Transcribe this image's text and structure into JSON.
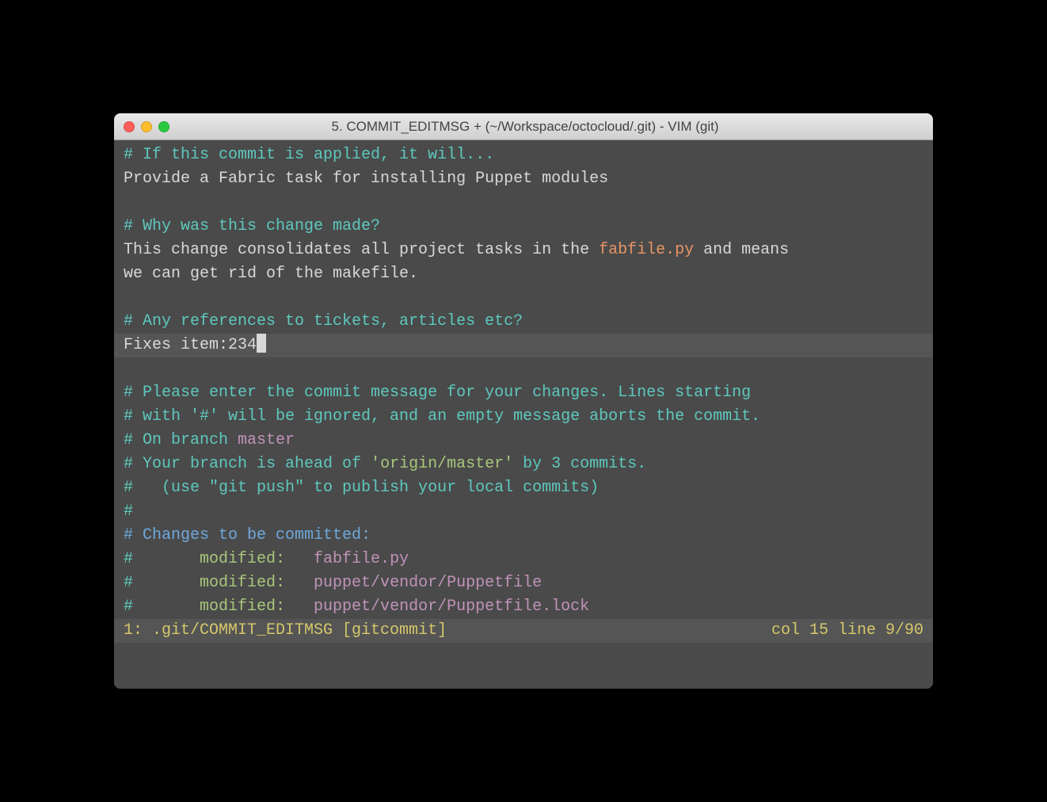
{
  "titlebar": {
    "title": "5. COMMIT_EDITMSG + (~/Workspace/octocloud/.git) - VIM (git)"
  },
  "lines": {
    "l1": "# If this commit is applied, it will...",
    "l2": "Provide a Fabric task for installing Puppet modules",
    "l3": "",
    "l4": "# Why was this change made?",
    "l5a": "This change consolidates all project tasks in the ",
    "l5b": "fabfile.py",
    "l5c": " and means",
    "l6": "we can get rid of the makefile.",
    "l7": "",
    "l8": "# Any references to tickets, articles etc?",
    "l9": "Fixes item:234",
    "l10": "",
    "l11": "# Please enter the commit message for your changes. Lines starting",
    "l12": "# with '#' will be ignored, and an empty message aborts the commit.",
    "l13a": "# On branch ",
    "l13b": "master",
    "l14a": "# Your branch is ahead of ",
    "l14b": "'origin/master'",
    "l14c": " by 3 commits.",
    "l15": "#   (use \"git push\" to publish your local commits)",
    "l16": "#",
    "l17": "# Changes to be committed:",
    "l18a": "#       ",
    "l18b": "modified:   ",
    "l18c": "fabfile.py",
    "l19a": "#       ",
    "l19b": "modified:   ",
    "l19c": "puppet/vendor/Puppetfile",
    "l20a": "#       ",
    "l20b": "modified:   ",
    "l20c": "puppet/vendor/Puppetfile.lock"
  },
  "statusbar": {
    "left": "1: .git/COMMIT_EDITMSG [gitcommit]",
    "right": "col 15 line 9/90"
  }
}
